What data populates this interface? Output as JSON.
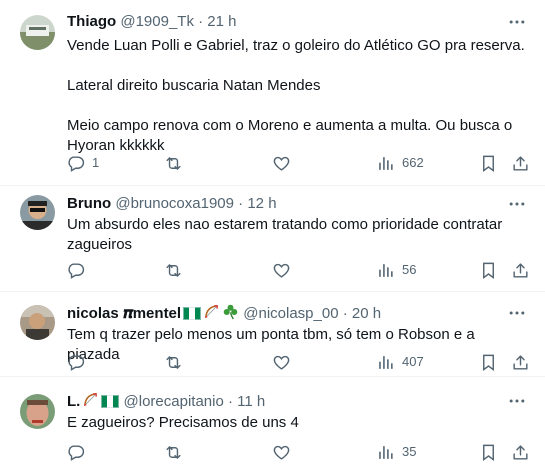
{
  "colors": {
    "text_primary": "#0f1419",
    "text_secondary": "#536471",
    "divider": "#eff3f4",
    "flag_green": "#008751"
  },
  "tweets": [
    {
      "name": "Thiago",
      "handle": "@1909_Tk",
      "separator": "·",
      "time": "21 h",
      "text": "Vende Luan Polli e Gabriel, traz o goleiro do Atlético GO pra reserva.\n\nLateral direito buscaria Natan Mendes\n\nMeio campo renova com o Moreno e aumenta a multa. Ou busca o Hyoran kkkkkk",
      "replies": "1",
      "reposts": "",
      "likes": "",
      "views": "662",
      "icons": [
        "more-icon",
        "reply-icon",
        "repost-icon",
        "like-icon",
        "views-icon",
        "bookmark-icon",
        "share-icon"
      ]
    },
    {
      "name": "Bruno",
      "handle": "@brunocoxa1909",
      "separator": "·",
      "time": "12 h",
      "text": "Um absurdo eles nao estarem tratando como prioridade contratar zagueiros",
      "replies": "",
      "reposts": "",
      "likes": "",
      "views": "56"
    },
    {
      "name": "nicolas 𝝅mentel",
      "handle": "@nicolasp_00",
      "separator": "·",
      "time": "20 h",
      "text": "Tem q trazer pelo menos um ponta tbm, só tem o Robson e a piazada",
      "replies": "",
      "reposts": "",
      "likes": "",
      "views": "407",
      "name_emojis": [
        "nigeria-flag-icon",
        "bow-and-arrow-icon",
        "shamrock-icon"
      ]
    },
    {
      "name": "L.",
      "handle": "@lorecapitanio",
      "separator": "·",
      "time": "11 h",
      "text": "E zagueiros? Precisamos de uns 4",
      "replies": "",
      "reposts": "",
      "likes": "",
      "views": "35",
      "name_emojis": [
        "bow-and-arrow-icon",
        "nigeria-flag-icon"
      ]
    }
  ]
}
